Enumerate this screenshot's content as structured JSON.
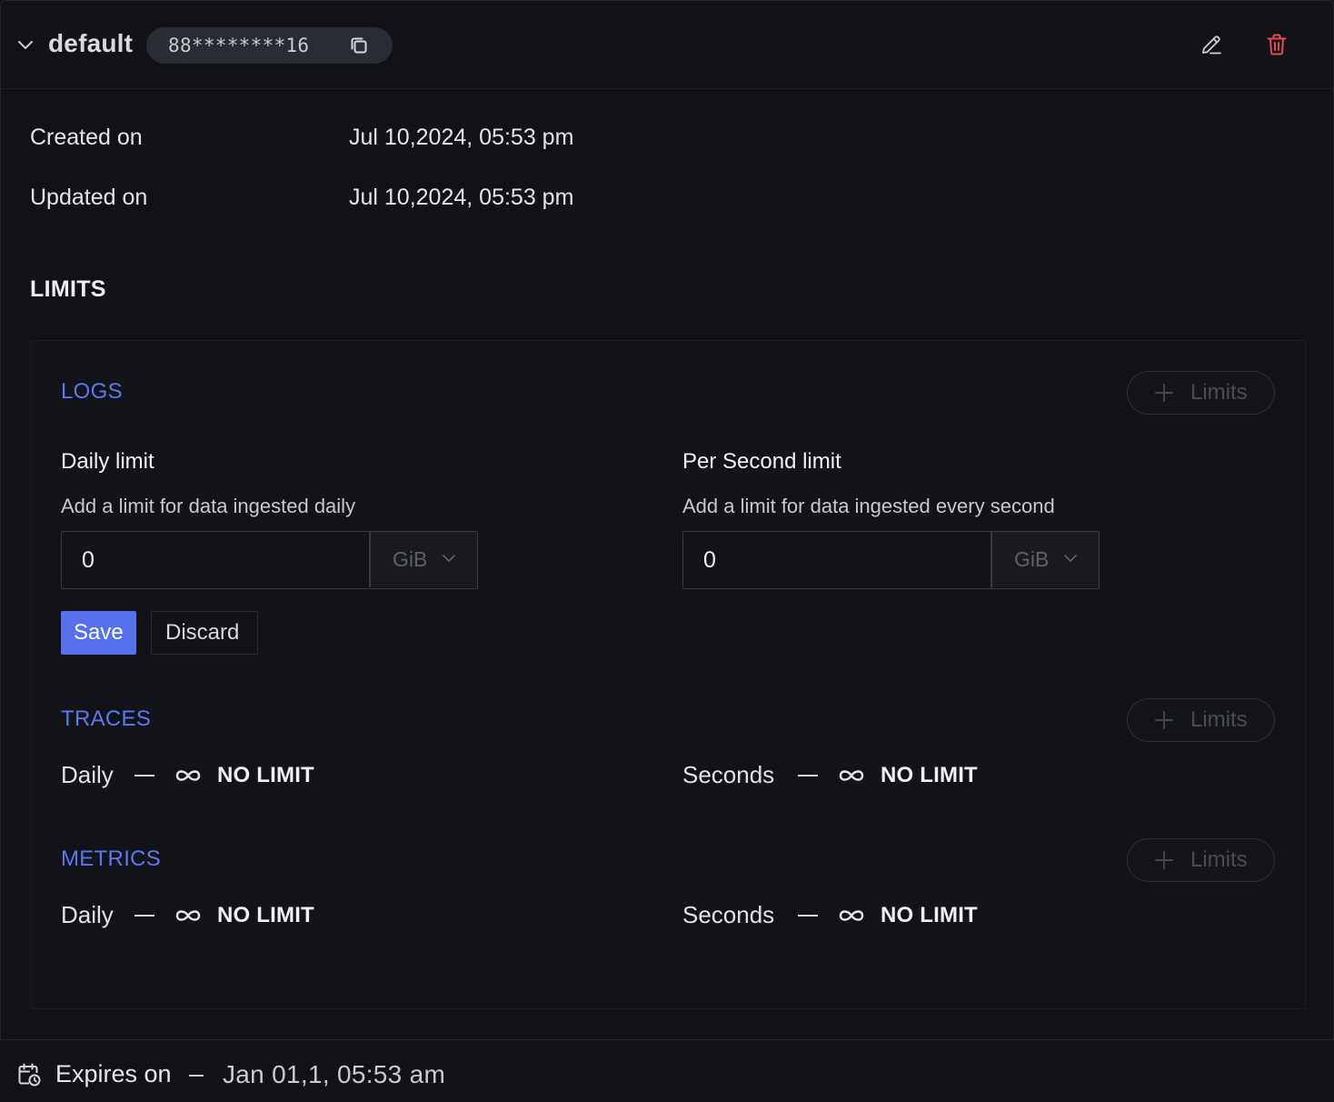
{
  "key": {
    "name": "default",
    "masked_value": "88********16"
  },
  "meta": {
    "created_label": "Created on",
    "created_value": "Jul 10,2024, 05:53 pm",
    "updated_label": "Updated on",
    "updated_value": "Jul 10,2024, 05:53 pm"
  },
  "limits": {
    "heading": "LIMITS",
    "add_button_label": "Limits",
    "logs": {
      "title": "LOGS",
      "daily": {
        "title": "Daily limit",
        "description": "Add a limit for data ingested daily",
        "value": "0",
        "unit": "GiB"
      },
      "per_second": {
        "title": "Per Second limit",
        "description": "Add a limit for data ingested every second",
        "value": "0",
        "unit": "GiB"
      },
      "save_label": "Save",
      "discard_label": "Discard"
    },
    "traces": {
      "title": "TRACES",
      "daily_label": "Daily",
      "daily_value": "NO LIMIT",
      "seconds_label": "Seconds",
      "seconds_value": "NO LIMIT"
    },
    "metrics": {
      "title": "METRICS",
      "daily_label": "Daily",
      "daily_value": "NO LIMIT",
      "seconds_label": "Seconds",
      "seconds_value": "NO LIMIT"
    }
  },
  "footer": {
    "expires_label": "Expires on",
    "expires_value": "Jan 01,1, 05:53 am"
  },
  "colors": {
    "accent": "#5670ee",
    "section_title": "#5a78ee",
    "delete": "#e5484d",
    "background": "#121317"
  }
}
